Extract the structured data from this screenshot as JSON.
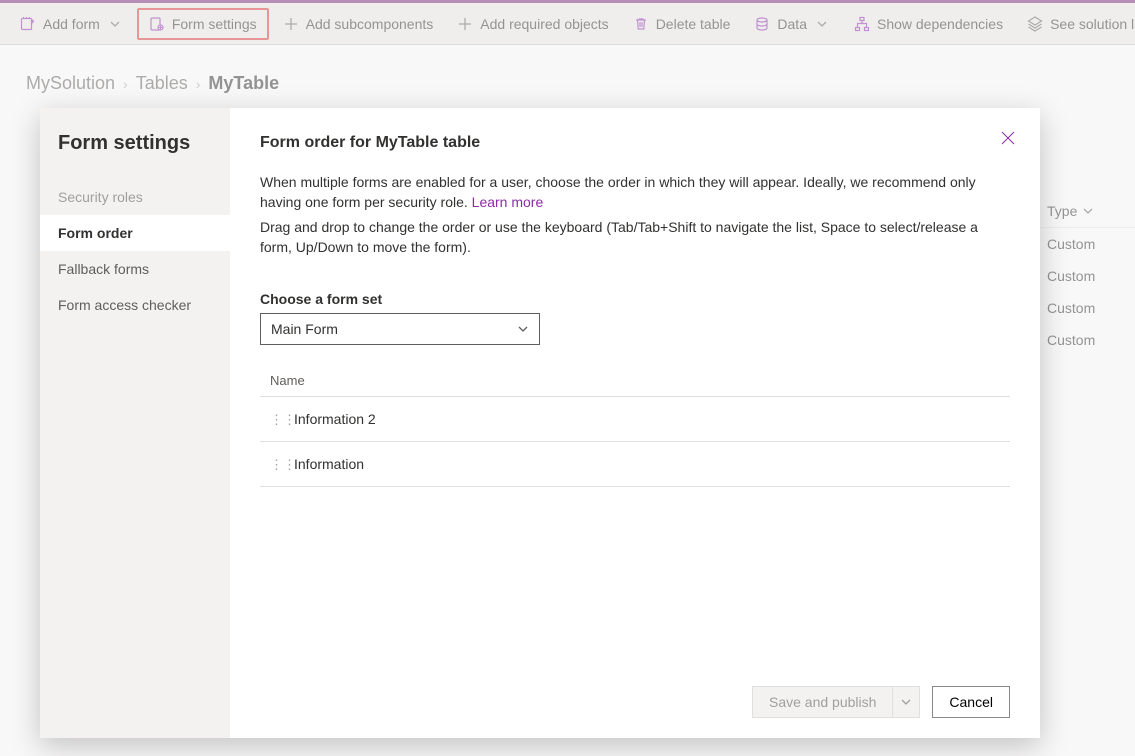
{
  "toolbar": {
    "add_form": "Add form",
    "form_settings": "Form settings",
    "add_subcomponents": "Add subcomponents",
    "add_required_objects": "Add required objects",
    "delete_table": "Delete table",
    "data": "Data",
    "show_dependencies": "Show dependencies",
    "see_solution_layers": "See solution layers"
  },
  "breadcrumb": {
    "root": "MySolution",
    "mid": "Tables",
    "current": "MyTable"
  },
  "bg_grid": {
    "header": "Type",
    "rows": [
      "Custom",
      "Custom",
      "Custom",
      "Custom"
    ]
  },
  "dialog": {
    "sidebar_title": "Form settings",
    "nav": {
      "security_roles": "Security roles",
      "form_order": "Form order",
      "fallback_forms": "Fallback forms",
      "form_access_checker": "Form access checker"
    },
    "title": "Form order for MyTable table",
    "desc1": "When multiple forms are enabled for a user, choose the order in which they will appear. Ideally, we recommend only having one form per security role. ",
    "learn_more": "Learn more",
    "desc2": "Drag and drop to change the order or use the keyboard (Tab/Tab+Shift to navigate the list, Space to select/release a form, Up/Down to move the form).",
    "formset_label": "Choose a form set",
    "formset_value": "Main Form",
    "list_header": "Name",
    "rows": [
      "Information 2",
      "Information"
    ],
    "save_publish": "Save and publish",
    "cancel": "Cancel"
  }
}
